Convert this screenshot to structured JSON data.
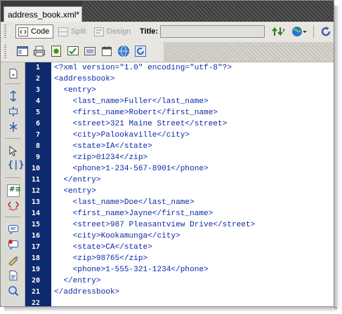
{
  "document_tab": {
    "label": "address_book.xml*"
  },
  "toolbar": {
    "code_label": "Code",
    "split_label": "Split",
    "design_label": "Design",
    "title_label": "Title:",
    "title_value": ""
  },
  "colors": {
    "gutter": "#0d2a6e",
    "code_text": "#0a29a8",
    "tab_bar": "#3b3b3b"
  },
  "editor": {
    "lines": [
      {
        "num": "1",
        "text": "<?xml version=\"1.0\" encoding=\"utf-8\"?>"
      },
      {
        "num": "2",
        "text": "<addressbook>"
      },
      {
        "num": "3",
        "text": "  <entry>"
      },
      {
        "num": "4",
        "text": "    <last_name>Fuller</last_name>"
      },
      {
        "num": "5",
        "text": "    <first_name>Robert</first_name>"
      },
      {
        "num": "6",
        "text": "    <street>321 Maine Street</street>"
      },
      {
        "num": "7",
        "text": "    <city>Palookaville</city>"
      },
      {
        "num": "8",
        "text": "    <state>IA</state>"
      },
      {
        "num": "9",
        "text": "    <zip>01234</zip>"
      },
      {
        "num": "10",
        "text": "    <phone>1-234-567-8901</phone>"
      },
      {
        "num": "11",
        "text": "  </entry>"
      },
      {
        "num": "12",
        "text": "  <entry>"
      },
      {
        "num": "13",
        "text": "    <last_name>Doe</last_name>"
      },
      {
        "num": "14",
        "text": "    <first_name>Jayne</first_name>"
      },
      {
        "num": "15",
        "text": "    <street>987 Pleasantview Drive</street>"
      },
      {
        "num": "16",
        "text": "    <city>Kookamunga</city>"
      },
      {
        "num": "17",
        "text": "    <state>CA</state>"
      },
      {
        "num": "18",
        "text": "    <zip>98765</zip>"
      },
      {
        "num": "19",
        "text": "    <phone>1-555-321-1234</phone>"
      },
      {
        "num": "20",
        "text": "  </entry>"
      },
      {
        "num": "21",
        "text": "</addressbook>"
      },
      {
        "num": "22",
        "text": ""
      }
    ]
  }
}
